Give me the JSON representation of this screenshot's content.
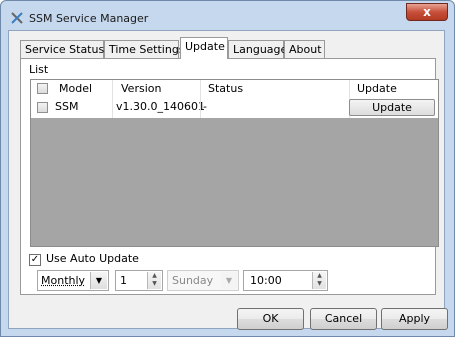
{
  "window": {
    "title": "SSM Service Manager",
    "close_symbol": "x"
  },
  "tabs": [
    "Service Status",
    "Time Settings",
    "Update",
    "Language",
    "About"
  ],
  "active_tab": "Update",
  "list": {
    "label": "List",
    "columns": [
      "Model",
      "Version",
      "Status",
      "Update"
    ],
    "rows": [
      {
        "model": "SSM",
        "version": "v1.30.0_140601",
        "status": "-",
        "update_label": "Update",
        "checked": false
      }
    ]
  },
  "auto_update": {
    "label": "Use Auto Update",
    "checked": true,
    "frequency": "Monthly",
    "interval": "1",
    "day": "Sunday",
    "time": "10:00"
  },
  "buttons": {
    "ok": "OK",
    "cancel": "Cancel",
    "apply": "Apply"
  },
  "colors": {
    "grid_empty": "#a5a5a5",
    "title_bar": "#c5d8ee",
    "close_button": "#c7503a"
  }
}
